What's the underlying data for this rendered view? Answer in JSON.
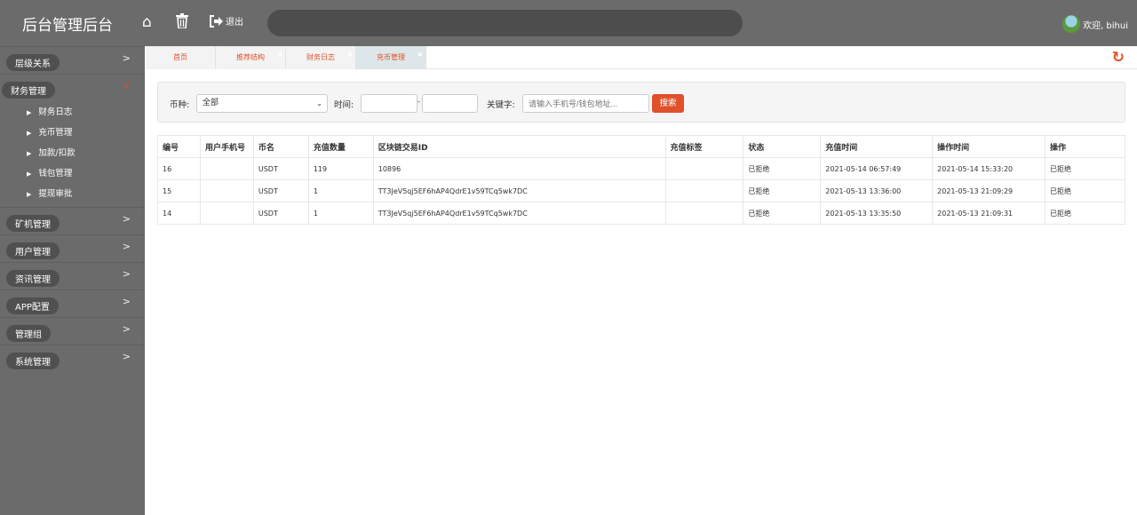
{
  "header": {
    "title": "后台管理后台",
    "logout": "退出",
    "welcome": "欢迎, bihui",
    "icons": [
      "home-icon",
      "trash-icon",
      "sign-out-icon"
    ]
  },
  "sidebar": [
    {
      "label": "层级关系",
      "open": false
    },
    {
      "label": "财务管理",
      "open": true,
      "items": [
        "财务日志",
        "充币管理",
        "加款/扣款",
        "钱包管理",
        "提现审批"
      ]
    },
    {
      "label": "矿机管理"
    },
    {
      "label": "用户管理"
    },
    {
      "label": "资讯管理"
    },
    {
      "label": "APP配置"
    },
    {
      "label": "管理组"
    },
    {
      "label": "系统管理"
    }
  ],
  "tabs": [
    {
      "label": "首页"
    },
    {
      "label": "推荐结构"
    },
    {
      "label": "财务日志"
    },
    {
      "label": "充币管理",
      "active": true
    }
  ],
  "filter": {
    "coin_label": "币种:",
    "coin_value": "全部",
    "time_label": "时间:",
    "dash": "-",
    "keyword_label": "关键字:",
    "keyword_placeholder": "请输入手机号/钱包地址...",
    "search": "搜索"
  },
  "table": {
    "headers": [
      "编号",
      "用户手机号",
      "币名",
      "充值数量",
      "区块链交易ID",
      "充值标签",
      "状态",
      "充值时间",
      "操作时间",
      "操作"
    ],
    "rows": [
      [
        "16",
        "",
        "USDT",
        "119",
        "10896",
        "",
        "已拒绝",
        "2021-05-14 06:57:49",
        "2021-05-14 15:33:20",
        "已拒绝"
      ],
      [
        "15",
        "",
        "USDT",
        "1",
        "TT3JeV5qj5EF6hAP4QdrE1v59TCq5wk7DC",
        "",
        "已拒绝",
        "2021-05-13 13:36:00",
        "2021-05-13 21:09:29",
        "已拒绝"
      ],
      [
        "14",
        "",
        "USDT",
        "1",
        "TT3JeV5qj5EF6hAP4QdrE1v59TCq5wk7DC",
        "",
        "已拒绝",
        "2021-05-13 13:35:50",
        "2021-05-13 21:09:31",
        "已拒绝"
      ]
    ]
  },
  "colors": {
    "accent": "#e0502a",
    "chrome": "#6b6b6b"
  }
}
